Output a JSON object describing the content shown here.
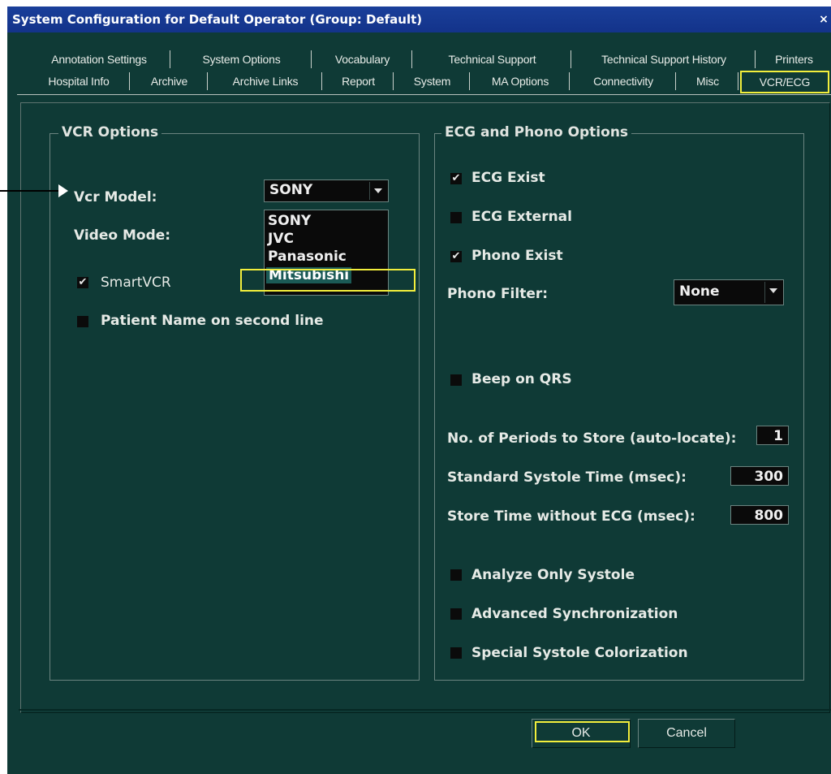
{
  "window": {
    "title": "System Configuration for Default Operator (Group: Default)",
    "close": "×"
  },
  "tabs_row1": [
    "Annotation Settings",
    "System Options",
    "Vocabulary",
    "Technical Support",
    "Technical Support History",
    "Printers"
  ],
  "tabs_row2": [
    "Hospital Info",
    "Archive",
    "Archive Links",
    "Report",
    "System",
    "MA Options",
    "Connectivity",
    "Misc",
    "VCR/ECG"
  ],
  "active_tab": "VCR/ECG",
  "vcr": {
    "group_title": "VCR Options",
    "vcr_model_label": "Vcr Model:",
    "vcr_model_value": "SONY",
    "video_mode_label": "Video Mode:",
    "dropdown_options": [
      "SONY",
      "JVC",
      "Panasonic",
      "Mitsubishi"
    ],
    "dropdown_selected": "Mitsubishi",
    "smartvcr_label": "SmartVCR",
    "smartvcr_checked": true,
    "patient_name_label": "Patient Name on second line",
    "patient_name_checked": false
  },
  "ecg": {
    "group_title": "ECG and Phono Options",
    "ecg_exist": {
      "label": "ECG Exist",
      "checked": true
    },
    "ecg_external": {
      "label": "ECG External",
      "checked": false
    },
    "phono_exist": {
      "label": "Phono Exist",
      "checked": true
    },
    "phono_filter_label": "Phono Filter:",
    "phono_filter_value": "None",
    "beep_on_qrs": {
      "label": "Beep on QRS",
      "checked": false
    },
    "periods_label": "No. of Periods to Store (auto-locate):",
    "periods_value": "1",
    "systole_label": "Standard Systole Time (msec):",
    "systole_value": "300",
    "store_time_label": "Store Time without ECG (msec):",
    "store_time_value": "800",
    "analyze_only_systole": {
      "label": "Analyze Only Systole",
      "checked": false
    },
    "advanced_sync": {
      "label": "Advanced Synchronization",
      "checked": false
    },
    "special_systole": {
      "label": "Special Systole Colorization",
      "checked": false
    }
  },
  "buttons": {
    "ok": "OK",
    "cancel": "Cancel"
  },
  "colors": {
    "background": "#0f3a36",
    "titlebar": "#13338a",
    "highlight": "#f2ee3c"
  }
}
